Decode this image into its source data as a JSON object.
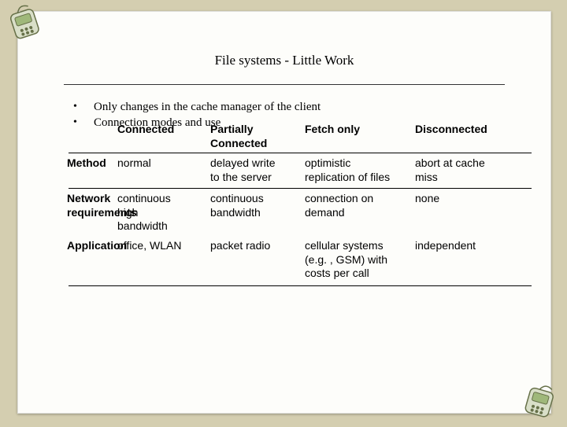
{
  "title": "File systems - Little Work",
  "bullets": {
    "b1": "Only changes in the cache manager of the client",
    "b2": "Connection modes and use"
  },
  "table": {
    "headers": {
      "c1": "Connected",
      "c2": "Partially\nConnected",
      "c3": "Fetch only",
      "c4": "Disconnected"
    },
    "rows": {
      "method": {
        "label": "Method",
        "c1": "normal",
        "c2": "delayed write\nto the server",
        "c3": "optimistic\nreplication of files",
        "c4": "abort at cache\nmiss"
      },
      "network": {
        "label": "Network\nrequirements",
        "c1": "continuous\nhigh\nbandwidth",
        "c2": "continuous\nbandwidth",
        "c3": "connection on\ndemand",
        "c4": "none"
      },
      "application": {
        "label": "Application",
        "c1": "office, WLAN",
        "c2": "packet radio",
        "c3": "cellular systems\n(e.g. , GSM) with\ncosts per call",
        "c4": "independent"
      }
    }
  },
  "chart_data": {
    "type": "table",
    "title": "File systems - Little Work",
    "columns": [
      "",
      "Connected",
      "Partially Connected",
      "Fetch only",
      "Disconnected"
    ],
    "rows": [
      [
        "Method",
        "normal",
        "delayed write to the server",
        "optimistic replication of files",
        "abort at cache miss"
      ],
      [
        "Network requirements",
        "continuous high bandwidth",
        "continuous bandwidth",
        "connection on demand",
        "none"
      ],
      [
        "Application",
        "office, WLAN",
        "packet radio",
        "cellular systems (e.g., GSM) with costs per call",
        "independent"
      ]
    ]
  }
}
